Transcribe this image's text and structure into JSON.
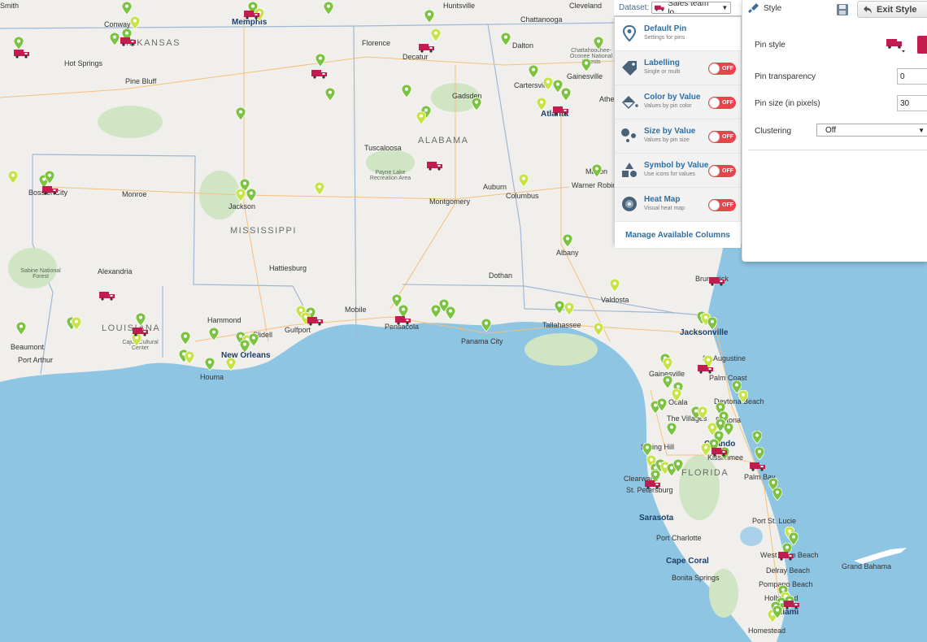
{
  "map": {
    "states": [
      "ARKANSAS",
      "ALABAMA",
      "MISSISSIPPI",
      "LOUISIANA",
      "FLORIDA"
    ],
    "cities": [
      "Memphis",
      "Florence",
      "Decatur",
      "Huntsville",
      "Chattanooga",
      "Cleveland",
      "Dalton",
      "Gainesville",
      "Cartersville",
      "Atlanta",
      "Athens",
      "Hot Springs",
      "Pine Bluff",
      "Conway",
      "Gadsden",
      "Tuscaloosa",
      "Jackson",
      "Monroe",
      "Bossier City",
      "Alexandria",
      "Hattiesburg",
      "Montgomery",
      "Auburn",
      "Columbus",
      "Macon",
      "Warner Robins",
      "Albany",
      "Dothan",
      "Valdosta",
      "Tallahassee",
      "Panama City",
      "Pensacola",
      "Mobile",
      "Gulfport",
      "Slidell",
      "Hammond",
      "New Orleans",
      "Houma",
      "Beaumont",
      "Port Arthur",
      "Jacksonville",
      "Brunswick",
      "St. Augustine",
      "Palm Coast",
      "Gainesville",
      "Ocala",
      "Daytona Beach",
      "The Villages",
      "Deltona",
      "Orlando",
      "Kissimmee",
      "Spring Hill",
      "Clearwater",
      "St. Petersburg",
      "Palm Bay",
      "Sarasota",
      "Port Charlotte",
      "Cape Coral",
      "Bonita Springs",
      "Port St. Lucie",
      "West Palm Beach",
      "Delray Beach",
      "Pompano Beach",
      "Hollywood",
      "Miami",
      "Homestead",
      "Grand Bahama",
      "Smith",
      "Sabine National Forest",
      "Cajun Cultural Center",
      "Chattahoochee-Oconee National Forests",
      "Payne Lake Recreation Area"
    ],
    "pin_green": "#7ec242",
    "pin_yellow": "#c8e34a",
    "truck_color": "#c21d4e",
    "water_color": "#8ec5e3",
    "land_color": "#f1efec"
  },
  "dataset": {
    "label": "Dataset:",
    "selected": "Sales team lo..."
  },
  "menu": {
    "items": [
      {
        "title": "Default Pin",
        "subtitle": "Settings for pins",
        "icon": "pin-icon"
      },
      {
        "title": "Labelling",
        "subtitle": "Single or multi",
        "icon": "tag-icon",
        "toggle": "OFF"
      },
      {
        "title": "Color by Value",
        "subtitle": "Values by pin color",
        "icon": "paint-bucket-icon",
        "toggle": "OFF"
      },
      {
        "title": "Size by Value",
        "subtitle": "Values by pin size",
        "icon": "circles-icon",
        "toggle": "OFF"
      },
      {
        "title": "Symbol by Value",
        "subtitle": "Use icons for values",
        "icon": "shapes-icon",
        "toggle": "OFF"
      },
      {
        "title": "Heat Map",
        "subtitle": "Visual heat map",
        "icon": "heat-map-icon",
        "toggle": "OFF"
      }
    ],
    "manage_label": "Manage Available Columns"
  },
  "style_panel": {
    "title": "Style",
    "exit_label": "Exit Style",
    "pin_style_label": "Pin style",
    "pin_color": "#c21d4e",
    "transparency_label": "Pin transparency",
    "transparency_value": "0",
    "size_label": "Pin size (in pixels)",
    "size_value": "30",
    "clustering_label": "Clustering",
    "clustering_value": "Off"
  }
}
